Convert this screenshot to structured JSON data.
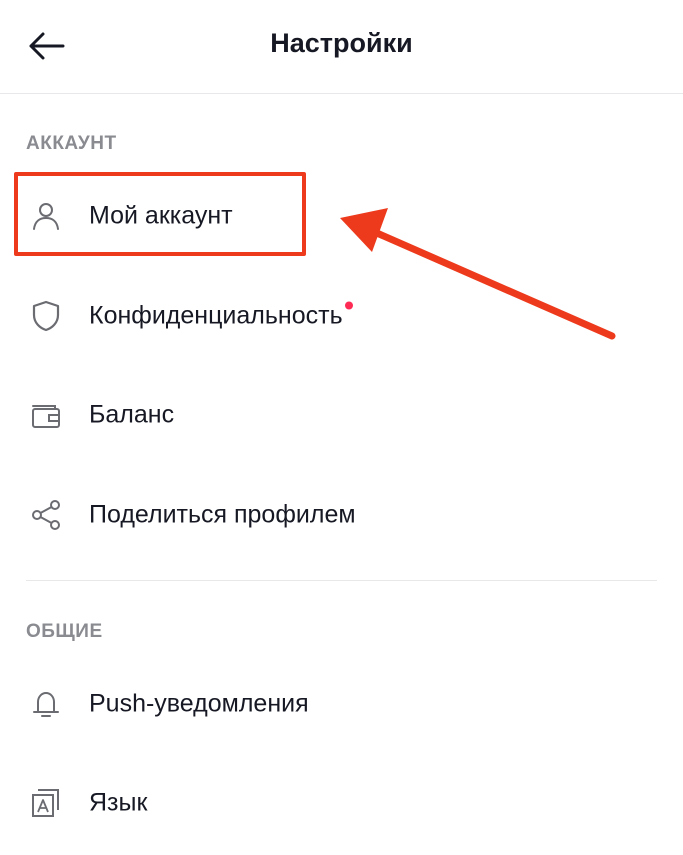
{
  "header": {
    "title": "Настройки",
    "back_icon": "arrow-left-icon"
  },
  "sections": {
    "account": {
      "label": "АККАУНТ",
      "items": [
        {
          "label": "Мой аккаунт",
          "icon": "person-icon"
        },
        {
          "label": "Конфиденциальность",
          "icon": "shield-icon",
          "badge": "red-dot"
        },
        {
          "label": "Баланс",
          "icon": "wallet-icon"
        },
        {
          "label": "Поделиться профилем",
          "icon": "share-icon"
        }
      ]
    },
    "general": {
      "label": "ОБЩИЕ",
      "items": [
        {
          "label": "Push-уведомления",
          "icon": "bell-icon"
        },
        {
          "label": "Язык",
          "icon": "language-icon"
        }
      ]
    }
  },
  "annotation": {
    "highlight_color": "#ee3a1c",
    "highlighted_item": "Мой аккаунт"
  },
  "colors": {
    "text": "#161823",
    "section_label": "#8a8b91",
    "divider": "#e8e8ea",
    "badge": "#fe2c55"
  }
}
